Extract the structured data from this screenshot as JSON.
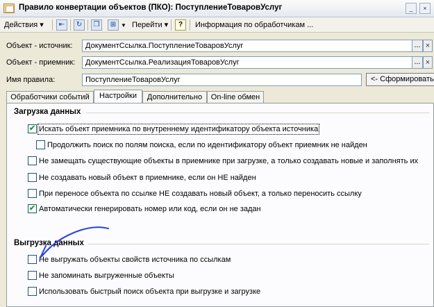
{
  "window": {
    "title": "Правило конвертации объектов (ПКО): ПоступлениеТоваровУслуг",
    "minimize": "_",
    "close": "×"
  },
  "toolbar": {
    "actions_label": "Действия ▾",
    "goto_label": "Перейти ▾",
    "help_label": "?",
    "info_label": "Информация по обработчикам ..."
  },
  "fields": {
    "source": {
      "label": "Объект - источник:",
      "value": "ДокументСсылка.ПоступлениеТоваровУслуг",
      "button": "..."
    },
    "receiver": {
      "label": "Объект - приемник:",
      "value": "ДокументСсылка.РеализацияТоваровУслуг",
      "button": "..."
    },
    "rule_name": {
      "label": "Имя правила:",
      "value": "ПоступлениеТоваровУслуг"
    },
    "generate_button": "<- Сформировать"
  },
  "tabs": [
    {
      "label": "Обработчики событий",
      "active": false
    },
    {
      "label": "Настройки",
      "active": true
    },
    {
      "label": "Дополнительно",
      "active": false
    },
    {
      "label": "On-line обмен",
      "active": false
    }
  ],
  "load_section": {
    "title": "Загрузка данных",
    "items": [
      {
        "label": "Искать объект приемника по внутреннему идентификатору объекта источника",
        "checked": true
      },
      {
        "label": "Продолжить поиск по полям поиска, если по идентификатору объект приемник не найден",
        "checked": false
      },
      {
        "label": "Не замещать существующие объекты в приемнике при загрузке, а только создавать новые и заполнять их",
        "checked": false
      },
      {
        "label": "Не создавать новый объект в приемнике, если он НЕ найден",
        "checked": false
      },
      {
        "label": "При переносе объекта по ссылке НЕ создавать новый объект, а только переносить ссылку",
        "checked": false
      },
      {
        "label": "Автоматически генерировать номер или код, если он не задан",
        "checked": true
      }
    ]
  },
  "unload_section": {
    "title": "Выгрузка данных",
    "items": [
      {
        "label": "Не выгружать объекты свойств источника по ссылкам",
        "checked": false
      },
      {
        "label": "Не запоминать выгруженные объекты",
        "checked": false
      },
      {
        "label": "Использовать быстрый поиск объекта при выгрузке и загрузке",
        "checked": false
      }
    ]
  },
  "check_glyph": "✔",
  "annotation_color": "#2b3fd8"
}
